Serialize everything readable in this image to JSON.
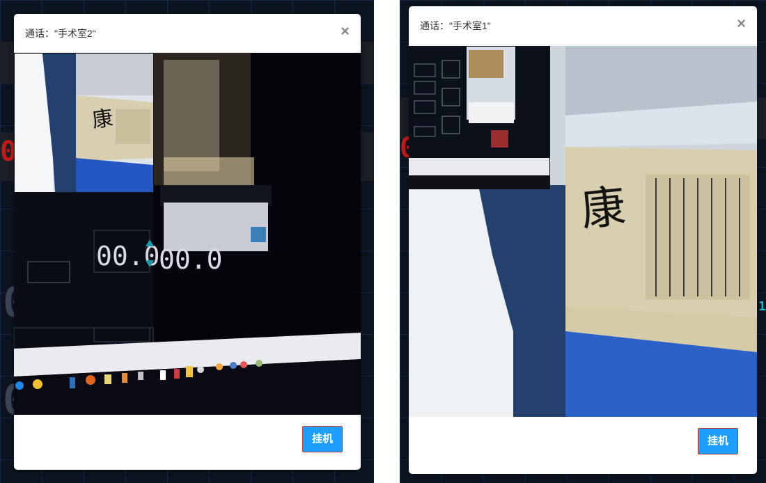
{
  "calls": [
    {
      "title": "通话：\"手术室2\"",
      "close_symbol": "×",
      "hangup_label": "挂机"
    },
    {
      "title": "通话：\"手术室1\"",
      "close_symbol": "×",
      "hangup_label": "挂机"
    }
  ],
  "feed_text": {
    "book_char": "康",
    "readout_a": "00.0",
    "readout_b": "00.0"
  },
  "colors": {
    "hangup_button": "#1e9fff",
    "backdrop": "#0b1420"
  }
}
